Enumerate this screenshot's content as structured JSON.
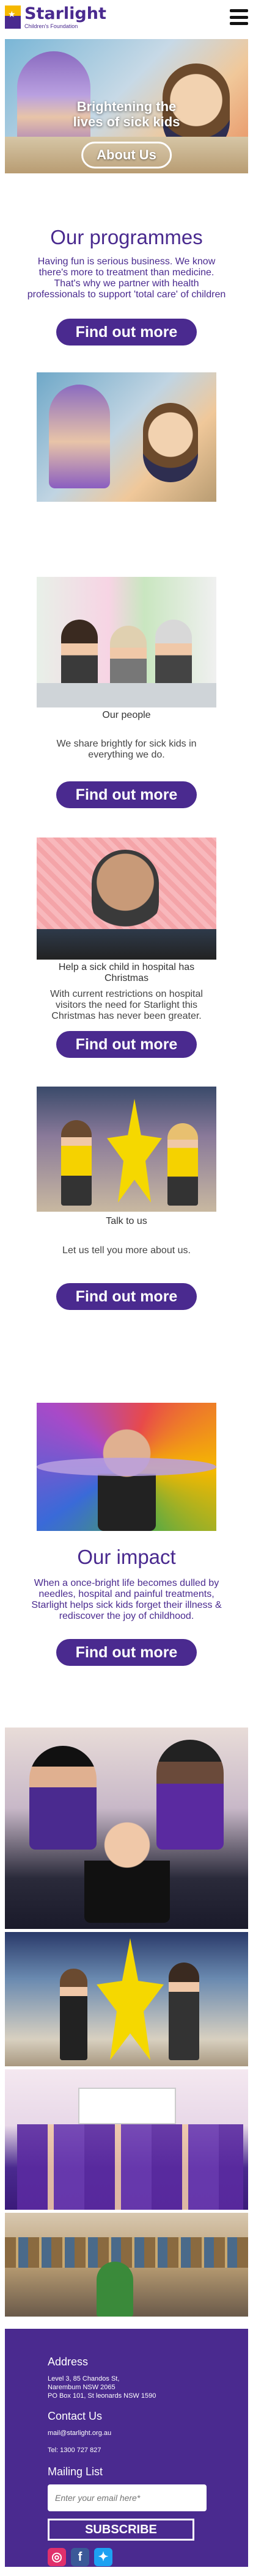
{
  "header": {
    "brand": "Starlight",
    "brand_sub": "Children's Foundation"
  },
  "hero": {
    "headline_1": "Brightening the",
    "headline_2": "lives of sick kids",
    "cta": "About Us"
  },
  "programmes": {
    "title": "Our programmes",
    "text": "Having fun is serious business. We know there's more to treatment than medicine. That's why we partner with health professionals to support 'total care' of children",
    "cta": "Find out more"
  },
  "people": {
    "caption": "Our people",
    "text": "We share brightly for sick kids in everything we do.",
    "cta": "Find out more"
  },
  "christmas": {
    "caption": "Help a sick child in hospital has Christmas",
    "text": "With current restrictions on hospital visitors the need for Starlight this Christmas has never been greater.",
    "cta": "Find out more"
  },
  "talk": {
    "caption": "Talk to us",
    "text": "Let us tell you more about us.",
    "cta": "Find out more"
  },
  "impact": {
    "title": "Our impact",
    "text": "When a once-bright life becomes dulled by needles, hospital and painful treatments, Starlight helps sick kids forget their illness & rediscover the joy of childhood.",
    "cta": "Find out more"
  },
  "footer": {
    "address_title": "Address",
    "address_1": "Level 3, 85 Chandos St,",
    "address_2": "Narembum NSW 2065",
    "address_3": "PO Box 101, St leonards NSW 1590",
    "contact_title": "Contact Us",
    "email": "mail@starlight.org.au",
    "tel": "Tel: 1300 727 827",
    "mailing_title": "Mailing List",
    "email_placeholder": "Enter your email here*",
    "subscribe": "SUBSCRIBE",
    "social": [
      {
        "icon": "instagram-icon",
        "glyph": "◎",
        "color": "#e1306c"
      },
      {
        "icon": "facebook-icon",
        "glyph": "f",
        "color": "#3b5998"
      },
      {
        "icon": "twitter-icon",
        "glyph": "✦",
        "color": "#1da1f2"
      }
    ]
  },
  "colors": {
    "brand_purple": "#4a2a8f",
    "brand_yellow": "#f5b800"
  }
}
